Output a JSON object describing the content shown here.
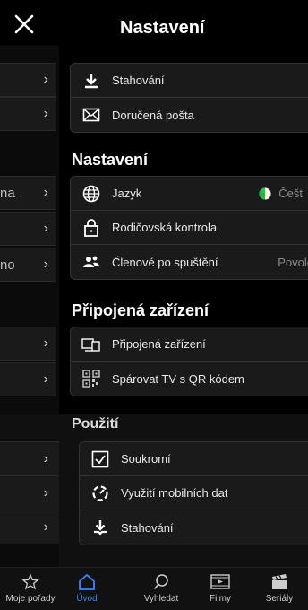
{
  "header": {
    "title": "Nastavení"
  },
  "background_panel": {
    "rows": [
      {
        "text": ""
      },
      {
        "text": ""
      },
      {
        "text": "na"
      },
      {
        "text": ""
      },
      {
        "text": "no"
      },
      {
        "text": ""
      },
      {
        "text": ""
      }
    ]
  },
  "group1": {
    "items": [
      {
        "label": "Stahování",
        "icon": "download-icon"
      },
      {
        "label": "Doručená pošta",
        "icon": "mail-icon"
      }
    ]
  },
  "settings_section": {
    "title": "Nastavení",
    "items": [
      {
        "label": "Jazyk",
        "value": "Češt",
        "icon": "globe-icon"
      },
      {
        "label": "Rodičovská kontrola",
        "icon": "lock-icon"
      },
      {
        "label": "Členové po spuštění",
        "value": "Povole",
        "icon": "members-icon"
      }
    ]
  },
  "devices_section": {
    "title": "Připojená zařízení",
    "items": [
      {
        "label": "Připojená zařízení",
        "icon": "devices-icon"
      },
      {
        "label": "Spárovat TV s QR kódem",
        "icon": "qr-icon"
      }
    ]
  },
  "privacy_section": {
    "title": "Použití",
    "items": [
      {
        "label": "Soukromí",
        "icon": "checkbox-icon"
      },
      {
        "label": "Využití mobilních dat",
        "icon": "data-usage-icon"
      },
      {
        "label": "Stahování",
        "icon": "download-icon"
      }
    ]
  },
  "tabbar": {
    "tabs": [
      {
        "label": "Moje pořady",
        "icon": "star-icon"
      },
      {
        "label": "Úvod",
        "icon": "home-icon",
        "active": true
      },
      {
        "label": "Vyhledat",
        "icon": "search-icon"
      },
      {
        "label": "Filmy",
        "icon": "film-icon"
      },
      {
        "label": "Seriály",
        "icon": "clapper-icon"
      }
    ]
  },
  "colors": {
    "background": "#000000",
    "row": "#1a1a1a",
    "accent": "#3b82f6"
  }
}
